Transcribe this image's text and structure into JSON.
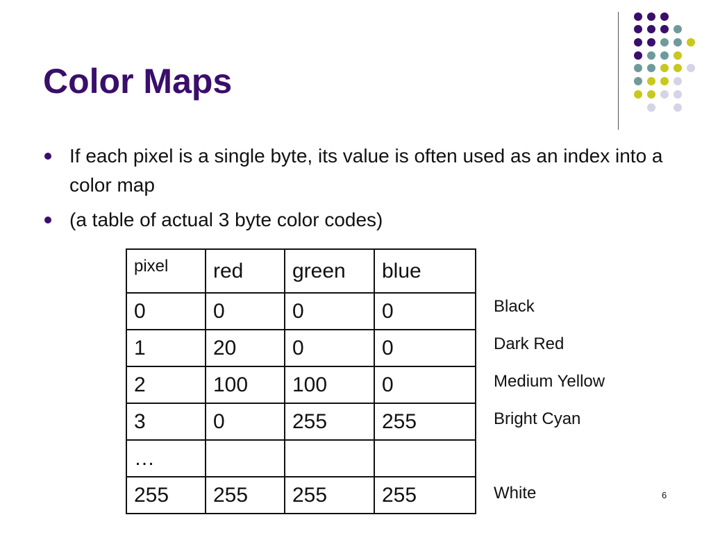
{
  "slide": {
    "title": "Color Maps",
    "page_number": "6",
    "bullets": [
      "If each pixel is a single byte, its value is often used as an index into a color map",
      "(a table of actual 3 byte color codes)"
    ],
    "table": {
      "headers": [
        "pixel",
        "red",
        "green",
        "blue"
      ],
      "rows": [
        [
          "0",
          "0",
          "0",
          "0"
        ],
        [
          "1",
          "20",
          "0",
          "0"
        ],
        [
          "2",
          "100",
          "100",
          "0"
        ],
        [
          "3",
          "0",
          "255",
          "255"
        ],
        [
          "…",
          "",
          "",
          ""
        ],
        [
          "255",
          "255",
          "255",
          "255"
        ]
      ]
    },
    "color_labels": [
      "Black",
      "Dark Red",
      "Medium Yellow",
      "Bright Cyan",
      "White"
    ]
  },
  "theme": {
    "title_color": "#3a0e6b",
    "dot_colors": {
      "purple": "#3a0e6b",
      "teal": "#6f9a9b",
      "yellow": "#c8c81e",
      "lavender": "#d4d4e6"
    }
  }
}
